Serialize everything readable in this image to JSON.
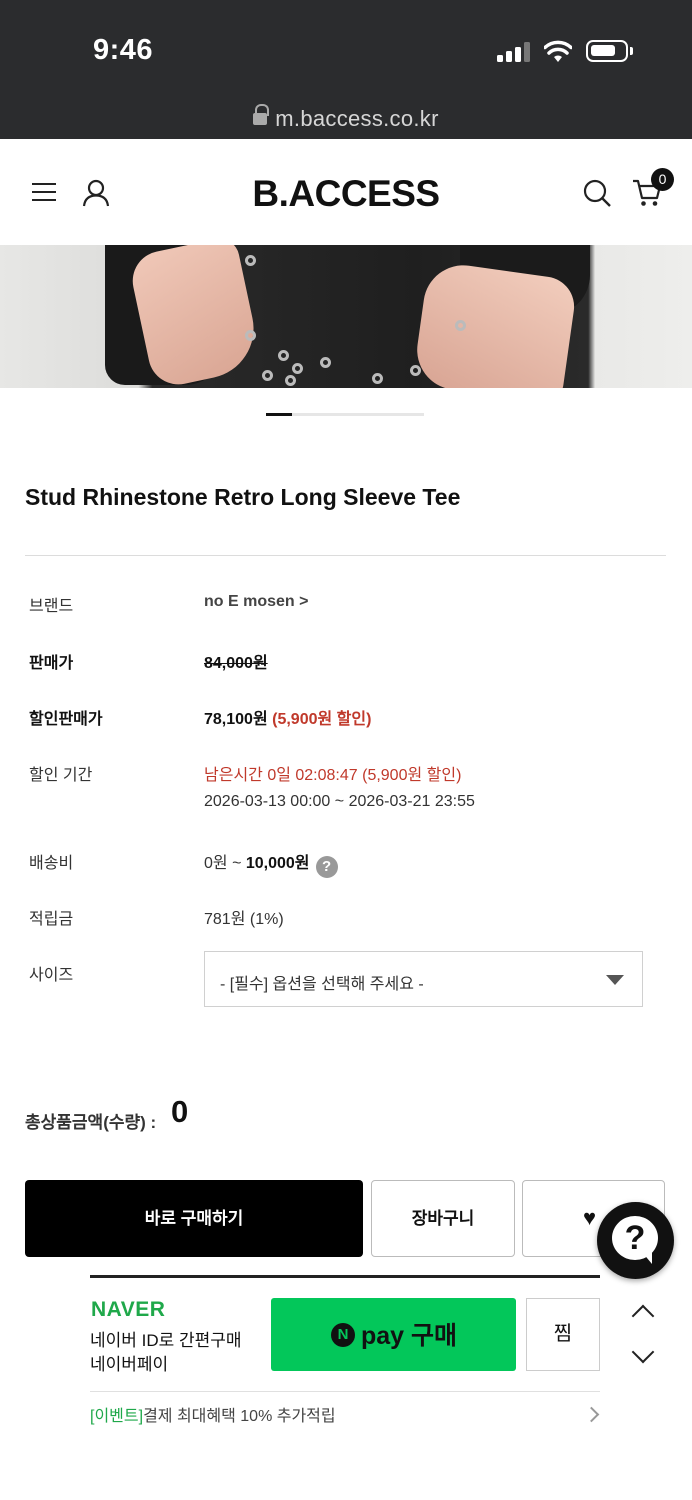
{
  "status_bar": {
    "time": "9:46"
  },
  "browser": {
    "url": "m.baccess.co.kr"
  },
  "header": {
    "logo": "B.ACCESS",
    "cart_count": "0"
  },
  "carousel": {
    "current_index": 1
  },
  "product": {
    "title": "Stud Rhinestone Retro Long Sleeve Tee",
    "rows": {
      "brand": {
        "label": "브랜드",
        "value": "no E mosen >"
      },
      "price": {
        "label": "판매가",
        "value": "84,000원"
      },
      "sale_price": {
        "label": "할인판매가",
        "value": "78,100원",
        "discount": "(5,900원 할인)"
      },
      "sale_period": {
        "label": "할인 기간",
        "remaining": "남은시간 0일 02:08:47 (5,900원 할인)",
        "range": "2026-03-13 00:00 ~ 2026-03-21 23:55"
      },
      "shipping": {
        "label": "배송비",
        "min": "0원 ~ ",
        "max": "10,000원",
        "help": "?"
      },
      "points": {
        "label": "적립금",
        "value": "781원 (1%)"
      },
      "size": {
        "label": "사이즈",
        "placeholder": "- [필수] 옵션을 선택해 주세요 -"
      }
    },
    "total": {
      "label": "총상품금액(수량) : ",
      "value": "0"
    }
  },
  "actions": {
    "buy_now": "바로 구매하기",
    "add_to_cart": "장바구니",
    "wishlist_icon": "heart-icon"
  },
  "help_fab": {
    "label": "?"
  },
  "naver_pay": {
    "brand": "NAVER",
    "desc_line1": "네이버 ID로 간편구매",
    "desc_line2": "네이버페이",
    "n_badge": "N",
    "pay_button": "pay 구매",
    "zzim": "찜",
    "event_tag": "[이벤트]",
    "event_text": "결제 최대혜택 10% 추가적립"
  },
  "colors": {
    "accent_red": "#c0392b",
    "naver_green": "#03c75a",
    "dark": "#2b2c2e"
  }
}
